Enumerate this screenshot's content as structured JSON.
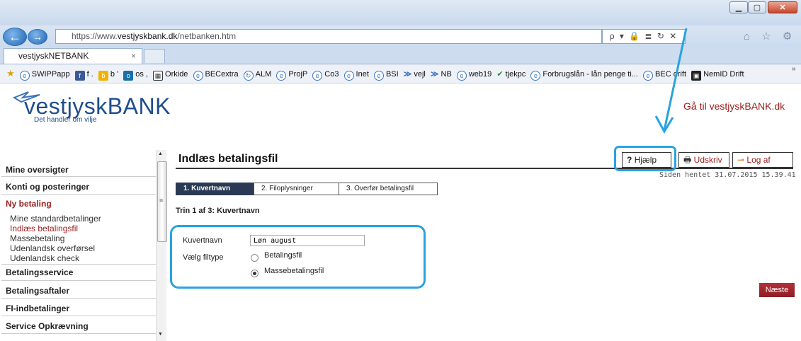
{
  "browser": {
    "url_prefix": "https://www.",
    "url_domain": "vestjyskbank.dk",
    "url_path": "/netbanken.htm",
    "tab_title": "vestjyskNETBANK",
    "tab_close": "×",
    "addr_tools": "ρ ▾ 🔒 ≣ ↻ ✕",
    "right_icons": "⌂ ☆ ⚙",
    "win_minimize": "▁",
    "win_maximize": "▢",
    "win_close": "✕",
    "back_glyph": "←",
    "forward_glyph": "→"
  },
  "favorites": [
    {
      "label": "SWIPPapp"
    },
    {
      "label": "f ."
    },
    {
      "label": "b '"
    },
    {
      "label": "os ,"
    },
    {
      "label": "Orkide"
    },
    {
      "label": "BECextra"
    },
    {
      "label": "ALM"
    },
    {
      "label": "ProjP"
    },
    {
      "label": "Co3"
    },
    {
      "label": "Inet"
    },
    {
      "label": "BSI"
    },
    {
      "label": "vejl"
    },
    {
      "label": "NB"
    },
    {
      "label": "web19"
    },
    {
      "label": "tjekpc"
    },
    {
      "label": "Forbrugslån - lån penge ti..."
    },
    {
      "label": "BEC drift"
    },
    {
      "label": "NemID Drift"
    }
  ],
  "favorites_more": "»",
  "brand": {
    "name": "vestjyskBANK",
    "tagline": "Det handler om vilje",
    "goto_link": "Gå til vestjyskBANK.dk"
  },
  "sidebar": {
    "items": [
      {
        "label": "Mine oversigter"
      },
      {
        "label": "Konti og posteringer"
      },
      {
        "label": "Ny betaling"
      },
      {
        "label": "Betalingsservice"
      },
      {
        "label": "Betalingsaftaler"
      },
      {
        "label": "FI-indbetalinger"
      },
      {
        "label": "Service Opkrævning"
      }
    ],
    "subitems": [
      {
        "label": "Mine standardbetalinger"
      },
      {
        "label": "Indlæs betalingsfil"
      },
      {
        "label": "Massebetaling"
      },
      {
        "label": "Udenlandsk overførsel"
      },
      {
        "label": "Udenlandsk check"
      }
    ],
    "scroll_up": "▲",
    "scroll_down": "▼",
    "scroll_grip": "≡"
  },
  "page": {
    "title": "Indlæs betalingsfil",
    "help": "Hjælp",
    "print": "Udskriv",
    "logout": "Log af",
    "retrieved": "Siden hentet 31.07.2015 15.39.41",
    "steps": [
      "1. Kuvertnavn",
      "2. Filoplysninger",
      "3. Overfør betalingsfil"
    ],
    "step_caption": "Trin 1 af 3: Kuvertnavn",
    "envelope_label": "Kuvertnavn",
    "envelope_value": "Løn august",
    "filetype_label": "Vælg filtype",
    "radio_options": [
      "Betalingsfil",
      "Massebetalingsfil"
    ],
    "selected_option": "Massebetalingsfil",
    "next_button": "Næste"
  },
  "colors": {
    "accent_red": "#9a1c1c",
    "highlight_blue": "#29a3e0",
    "brand_blue": "#1f4d8f",
    "step_active": "#2a3a55"
  },
  "icons": {
    "help": "question-icon",
    "print": "printer-icon",
    "logout": "key-icon",
    "annotation": "arrow-pointer"
  }
}
